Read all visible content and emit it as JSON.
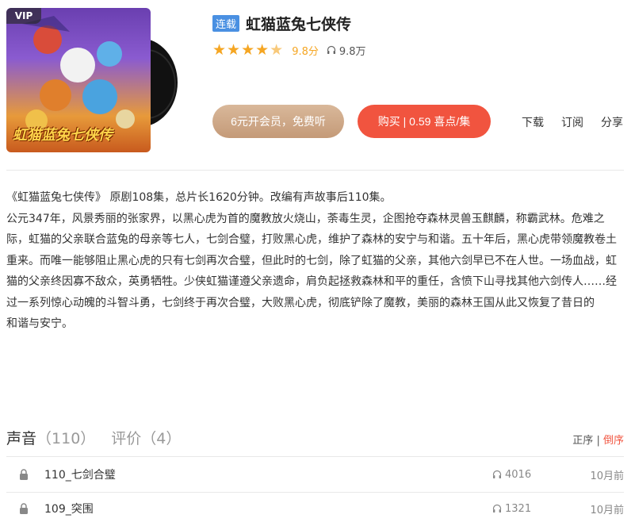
{
  "cover": {
    "badge": "VIP",
    "title_art": "虹猫蓝兔七侠传"
  },
  "album": {
    "tag": "连载",
    "title": "虹猫蓝兔七侠传",
    "rating_stars": 4.5,
    "score": "9.8分",
    "plays": "9.8万"
  },
  "buttons": {
    "vip": "6元开会员，免费听",
    "buy": "购买 | 0.59 喜点/集"
  },
  "actions": {
    "download": "下载",
    "subscribe": "订阅",
    "share": "分享"
  },
  "description": {
    "lines": [
      "《虹猫蓝兔七侠传》 原剧108集，总片长1620分钟。改编有声故事后110集。",
      "公元347年，风景秀丽的张家界，以黑心虎为首的魔教放火烧山，荼毒生灵，企图抢夺森林灵兽玉麒麟，称霸武林。危难之际，虹猫的父亲联合蓝兔的母亲等七人，七剑合璧，打败黑心虎，维护了森林的安宁与和谐。五十年后，黑心虎带领魔教卷土重来。而唯一能够阻止黑心虎的只有七剑再次合璧，但此时的七剑，除了虹猫的父亲，其他六剑早已不在人世。一场血战，虹猫的父亲终因寡不敌众，英勇牺牲。少侠虹猫谨遵父亲遗命，肩负起拯救森林和平的重任，含愤下山寻找其他六剑传人……经过一系列惊心动魄的斗智斗勇，七剑终于再次合璧，大败黑心虎，彻底铲除了魔教，美丽的森林王国从此又恢复了昔日的",
      "和谐与安宁。"
    ]
  },
  "tabs": [
    {
      "label": "声音",
      "count": "（110）"
    },
    {
      "label": "评价",
      "count": "（4）"
    }
  ],
  "sort": {
    "asc": "正序",
    "sep": "|",
    "desc": "倒序"
  },
  "tracks": [
    {
      "name": "110_七剑合璧",
      "plays": "4016",
      "ago": "10月前"
    },
    {
      "name": "109_突围",
      "plays": "1321",
      "ago": "10月前"
    }
  ],
  "colors": {
    "accent": "#f1543f",
    "star": "#f5a623",
    "tag": "#4a90e2",
    "vip_button": "#c49a78"
  }
}
